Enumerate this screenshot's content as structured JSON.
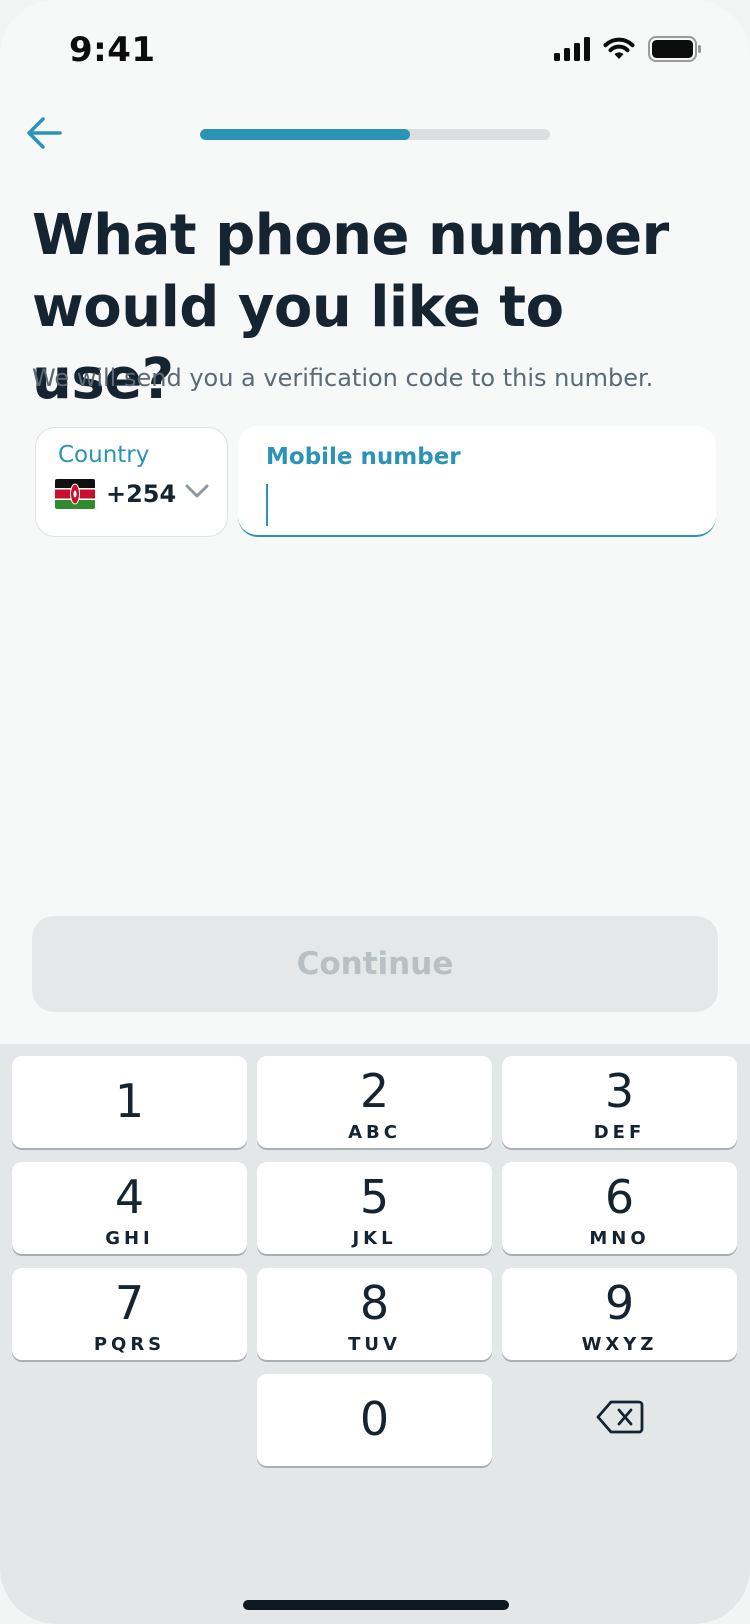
{
  "status_bar": {
    "time": "9:41",
    "icons": [
      "cellular-signal-icon",
      "wifi-icon",
      "battery-icon"
    ]
  },
  "nav": {
    "back_icon": "arrow-left-icon",
    "progress": 0.6
  },
  "heading": {
    "title": "What phone number would you like to use?",
    "subtitle": "We will send you a verification code to this number."
  },
  "country": {
    "label": "Country",
    "flag": "kenya-flag-icon",
    "dial_code": "+254"
  },
  "mobile": {
    "label": "Mobile number",
    "value": ""
  },
  "continue_label": "Continue",
  "keypad": {
    "keys": [
      {
        "digit": "1",
        "letters": ""
      },
      {
        "digit": "2",
        "letters": "ABC"
      },
      {
        "digit": "3",
        "letters": "DEF"
      },
      {
        "digit": "4",
        "letters": "GHI"
      },
      {
        "digit": "5",
        "letters": "JKL"
      },
      {
        "digit": "6",
        "letters": "MNO"
      },
      {
        "digit": "7",
        "letters": "PQRS"
      },
      {
        "digit": "8",
        "letters": "TUV"
      },
      {
        "digit": "9",
        "letters": "WXYZ"
      },
      {
        "digit": "0",
        "letters": ""
      }
    ],
    "backspace_icon": "backspace-icon"
  },
  "colors": {
    "accent": "#2b93b5",
    "title": "#142430",
    "disabled_button": "#e5e8e9",
    "keypad_bg": "#e4e7e8"
  }
}
